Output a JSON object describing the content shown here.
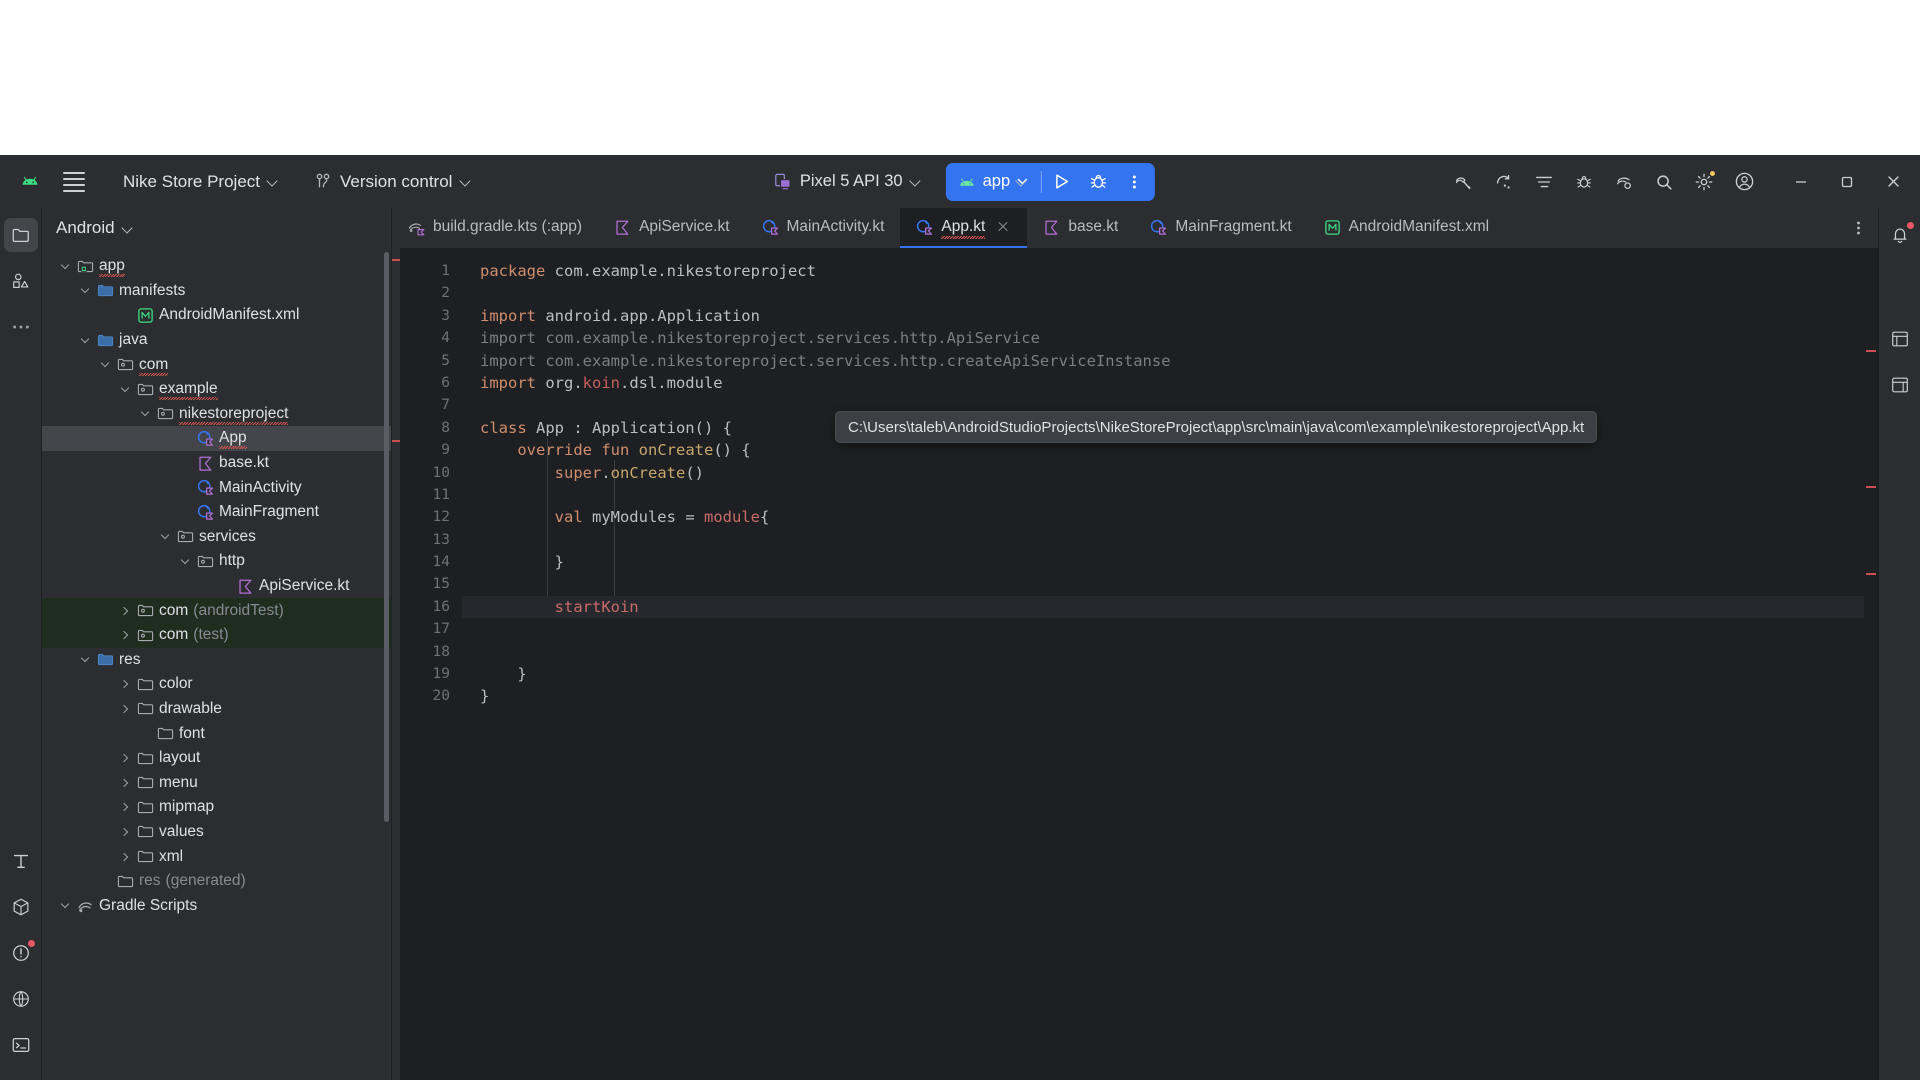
{
  "window": {
    "app_name": "Android Studio",
    "minimize_label": "Minimize",
    "maximize_label": "Maximize",
    "close_label": "Close"
  },
  "toolbar": {
    "project_name": "Nike Store Project",
    "version_control": "Version control",
    "device": "Pixel 5 API 30",
    "run_config": "app",
    "run_label": "Run",
    "debug_label": "Debug",
    "more_label": "More",
    "icons": [
      "android-logo-icon",
      "hamburger-menu-icon",
      "branch-icon",
      "device-icon",
      "run-icon",
      "debug-icon",
      "more-vertical-icon",
      "build-hammer-icon",
      "code-with-me-icon",
      "navigation-icon",
      "profiler-icon",
      "device-manager-icon",
      "search-icon",
      "settings-gear-icon",
      "account-icon"
    ],
    "accent_color": "#3574f0",
    "bg_color": "#2b2d30"
  },
  "project_panel": {
    "title": "Android",
    "tree": [
      {
        "label": "app",
        "depth": 0,
        "arrow": "expanded",
        "icon": "module-folder-icon",
        "squiggly": true
      },
      {
        "label": "manifests",
        "depth": 1,
        "arrow": "expanded",
        "icon": "folder-blue-icon"
      },
      {
        "label": "AndroidManifest.xml",
        "depth": 3,
        "arrow": "none",
        "icon": "manifest-xml-icon"
      },
      {
        "label": "java",
        "depth": 1,
        "arrow": "expanded",
        "icon": "folder-blue-icon"
      },
      {
        "label": "com",
        "depth": 2,
        "arrow": "expanded",
        "icon": "package-folder-icon",
        "squiggly": true
      },
      {
        "label": "example",
        "depth": 3,
        "arrow": "expanded",
        "icon": "package-folder-icon",
        "squiggly": true
      },
      {
        "label": "nikestoreproject",
        "depth": 4,
        "arrow": "expanded",
        "icon": "package-folder-icon",
        "squiggly": true
      },
      {
        "label": "App",
        "depth": 6,
        "arrow": "none",
        "icon": "kotlin-class-icon",
        "selected": true,
        "squiggly": true
      },
      {
        "label": "base.kt",
        "depth": 6,
        "arrow": "none",
        "icon": "kotlin-file-icon"
      },
      {
        "label": "MainActivity",
        "depth": 6,
        "arrow": "none",
        "icon": "kotlin-class-icon"
      },
      {
        "label": "MainFragment",
        "depth": 6,
        "arrow": "none",
        "icon": "kotlin-class-icon"
      },
      {
        "label": "services",
        "depth": 5,
        "arrow": "expanded",
        "icon": "package-folder-icon"
      },
      {
        "label": "http",
        "depth": 6,
        "arrow": "expanded",
        "icon": "package-folder-icon"
      },
      {
        "label": "ApiService.kt",
        "depth": 8,
        "arrow": "none",
        "icon": "kotlin-file-icon"
      },
      {
        "label": "com",
        "suffix": "(androidTest)",
        "depth": 3,
        "arrow": "collapsed",
        "icon": "package-folder-icon",
        "test": true
      },
      {
        "label": "com",
        "suffix": "(test)",
        "depth": 3,
        "arrow": "collapsed",
        "icon": "package-folder-icon",
        "test": true
      },
      {
        "label": "res",
        "depth": 1,
        "arrow": "expanded",
        "icon": "folder-blue-icon"
      },
      {
        "label": "color",
        "depth": 3,
        "arrow": "collapsed",
        "icon": "folder-gray-icon"
      },
      {
        "label": "drawable",
        "depth": 3,
        "arrow": "collapsed",
        "icon": "folder-gray-icon"
      },
      {
        "label": "font",
        "depth": 4,
        "arrow": "none",
        "icon": "folder-gray-icon"
      },
      {
        "label": "layout",
        "depth": 3,
        "arrow": "collapsed",
        "icon": "folder-gray-icon"
      },
      {
        "label": "menu",
        "depth": 3,
        "arrow": "collapsed",
        "icon": "folder-gray-icon"
      },
      {
        "label": "mipmap",
        "depth": 3,
        "arrow": "collapsed",
        "icon": "folder-gray-icon"
      },
      {
        "label": "values",
        "depth": 3,
        "arrow": "collapsed",
        "icon": "folder-gray-icon"
      },
      {
        "label": "xml",
        "depth": 3,
        "arrow": "collapsed",
        "icon": "folder-gray-icon"
      },
      {
        "label": "res",
        "suffix": "(generated)",
        "depth": 2,
        "arrow": "none",
        "icon": "folder-gray-icon",
        "dimmed": true
      },
      {
        "label": "Gradle Scripts",
        "depth": 0,
        "arrow": "expanded",
        "icon": "gradle-icon"
      }
    ]
  },
  "editor": {
    "tabs": [
      {
        "label": "build.gradle.kts (:app)",
        "icon": "gradle-kts-icon",
        "active": false
      },
      {
        "label": "ApiService.kt",
        "icon": "kotlin-file-icon",
        "active": false
      },
      {
        "label": "MainActivity.kt",
        "icon": "kotlin-class-icon",
        "active": false
      },
      {
        "label": "App.kt",
        "icon": "kotlin-class-icon",
        "active": true,
        "has_error": true,
        "closable": true
      },
      {
        "label": "base.kt",
        "icon": "kotlin-file-icon",
        "active": false
      },
      {
        "label": "MainFragment.kt",
        "icon": "kotlin-class-icon",
        "active": false
      },
      {
        "label": "AndroidManifest.xml",
        "icon": "manifest-xml-icon",
        "active": false
      }
    ],
    "tooltip": "C:\\Users\\taleb\\AndroidStudioProjects\\NikeStoreProject\\app\\src\\main\\java\\com\\example\\nikestoreproject\\App.kt",
    "line_count": 20,
    "current_line": 16,
    "lines": [
      {
        "n": 1,
        "tokens": [
          {
            "t": "package ",
            "c": "kw"
          },
          {
            "t": "com.example.nikestoreproject",
            "c": "plain"
          }
        ]
      },
      {
        "n": 2,
        "tokens": []
      },
      {
        "n": 3,
        "tokens": [
          {
            "t": "import ",
            "c": "kw"
          },
          {
            "t": "android.app.Application",
            "c": "plain"
          }
        ]
      },
      {
        "n": 4,
        "tokens": [
          {
            "t": "import com.example.nikestoreproject.services.http.ApiService",
            "c": "dim"
          }
        ]
      },
      {
        "n": 5,
        "tokens": [
          {
            "t": "import com.example.nikestoreproject.services.http.createApiServiceInstanse",
            "c": "dim"
          }
        ]
      },
      {
        "n": 6,
        "tokens": [
          {
            "t": "import ",
            "c": "kw"
          },
          {
            "t": "org.",
            "c": "plain"
          },
          {
            "t": "koin",
            "c": "pink"
          },
          {
            "t": ".dsl.module",
            "c": "plain"
          }
        ]
      },
      {
        "n": 7,
        "tokens": []
      },
      {
        "n": 8,
        "tokens": [
          {
            "t": "class ",
            "c": "kw"
          },
          {
            "t": "App : Application() {",
            "c": "plain"
          }
        ]
      },
      {
        "n": 9,
        "gutter": "override",
        "tokens": [
          {
            "t": "    ",
            "c": "plain"
          },
          {
            "t": "override fun ",
            "c": "kw"
          },
          {
            "t": "onCreate",
            "c": "fn"
          },
          {
            "t": "() {",
            "c": "plain"
          }
        ]
      },
      {
        "n": 10,
        "tokens": [
          {
            "t": "        ",
            "c": "plain"
          },
          {
            "t": "super",
            "c": "kw"
          },
          {
            "t": ".",
            "c": "plain"
          },
          {
            "t": "onCreate",
            "c": "fn"
          },
          {
            "t": "()",
            "c": "plain"
          }
        ]
      },
      {
        "n": 11,
        "tokens": []
      },
      {
        "n": 12,
        "tokens": [
          {
            "t": "        ",
            "c": "plain"
          },
          {
            "t": "val ",
            "c": "kw"
          },
          {
            "t": "myModules",
            "c": "plain"
          },
          {
            "t": " = ",
            "c": "plain"
          },
          {
            "t": "module",
            "c": "red"
          },
          {
            "t": "{",
            "c": "plain"
          }
        ]
      },
      {
        "n": 13,
        "tokens": []
      },
      {
        "n": 14,
        "tokens": [
          {
            "t": "        }",
            "c": "plain"
          }
        ]
      },
      {
        "n": 15,
        "tokens": []
      },
      {
        "n": 16,
        "gutter": "error",
        "current": true,
        "tokens": [
          {
            "t": "        ",
            "c": "plain"
          },
          {
            "t": "startKoin",
            "c": "red"
          }
        ]
      },
      {
        "n": 17,
        "tokens": []
      },
      {
        "n": 18,
        "tokens": []
      },
      {
        "n": 19,
        "tokens": [
          {
            "t": "    }",
            "c": "plain"
          }
        ]
      },
      {
        "n": 20,
        "tokens": [
          {
            "t": "}",
            "c": "plain"
          }
        ]
      }
    ]
  },
  "rails": {
    "left_items": [
      "project-folder-icon",
      "resource-manager-icon",
      "more-tools-icon"
    ],
    "left_bottom_items": [
      "terminal-text-icon",
      "build-variants-icon",
      "problems-icon",
      "app-quality-icon",
      "terminal-icon"
    ],
    "right_items": [
      "notifications-bell-icon",
      "gradle-panel-icon",
      "device-file-explorer-icon"
    ]
  },
  "colors": {
    "editor_bg": "#1e1f22",
    "panel_bg": "#2b2d30",
    "selection": "#43454a",
    "accent": "#3574f0",
    "error": "#e04a4a",
    "test_folder": "#1f2d1f"
  }
}
